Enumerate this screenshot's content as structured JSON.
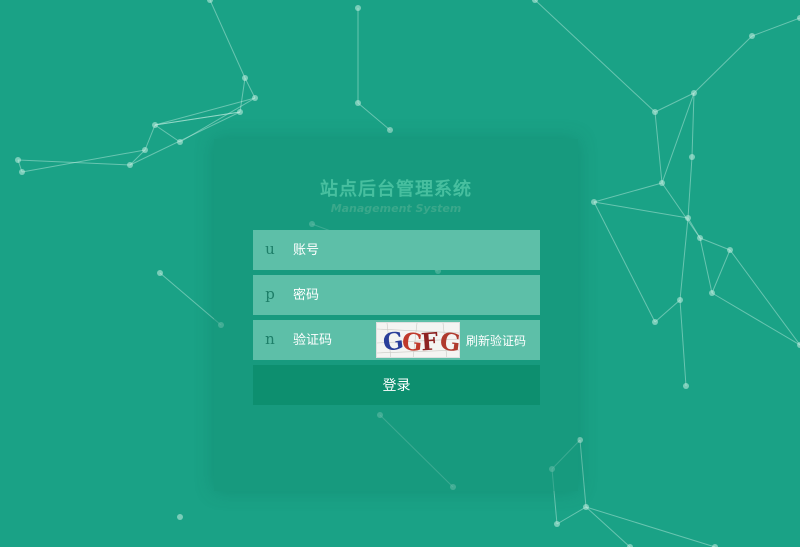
{
  "page": {
    "title": "站点后台管理系统",
    "subtitle": "Management System"
  },
  "form": {
    "username": {
      "prefix": "u",
      "placeholder": "账号",
      "value": ""
    },
    "password": {
      "prefix": "p",
      "placeholder": "密码",
      "value": ""
    },
    "captcha": {
      "prefix": "n",
      "placeholder": "验证码",
      "value": "",
      "image_text": "GGFG",
      "refresh_label": "刷新验证码"
    },
    "login_label": "登录"
  },
  "colors": {
    "background": "#1aa286",
    "field_background": "#5dbfa8",
    "button": "#0d8f6f",
    "title": "#47bf9f"
  }
}
